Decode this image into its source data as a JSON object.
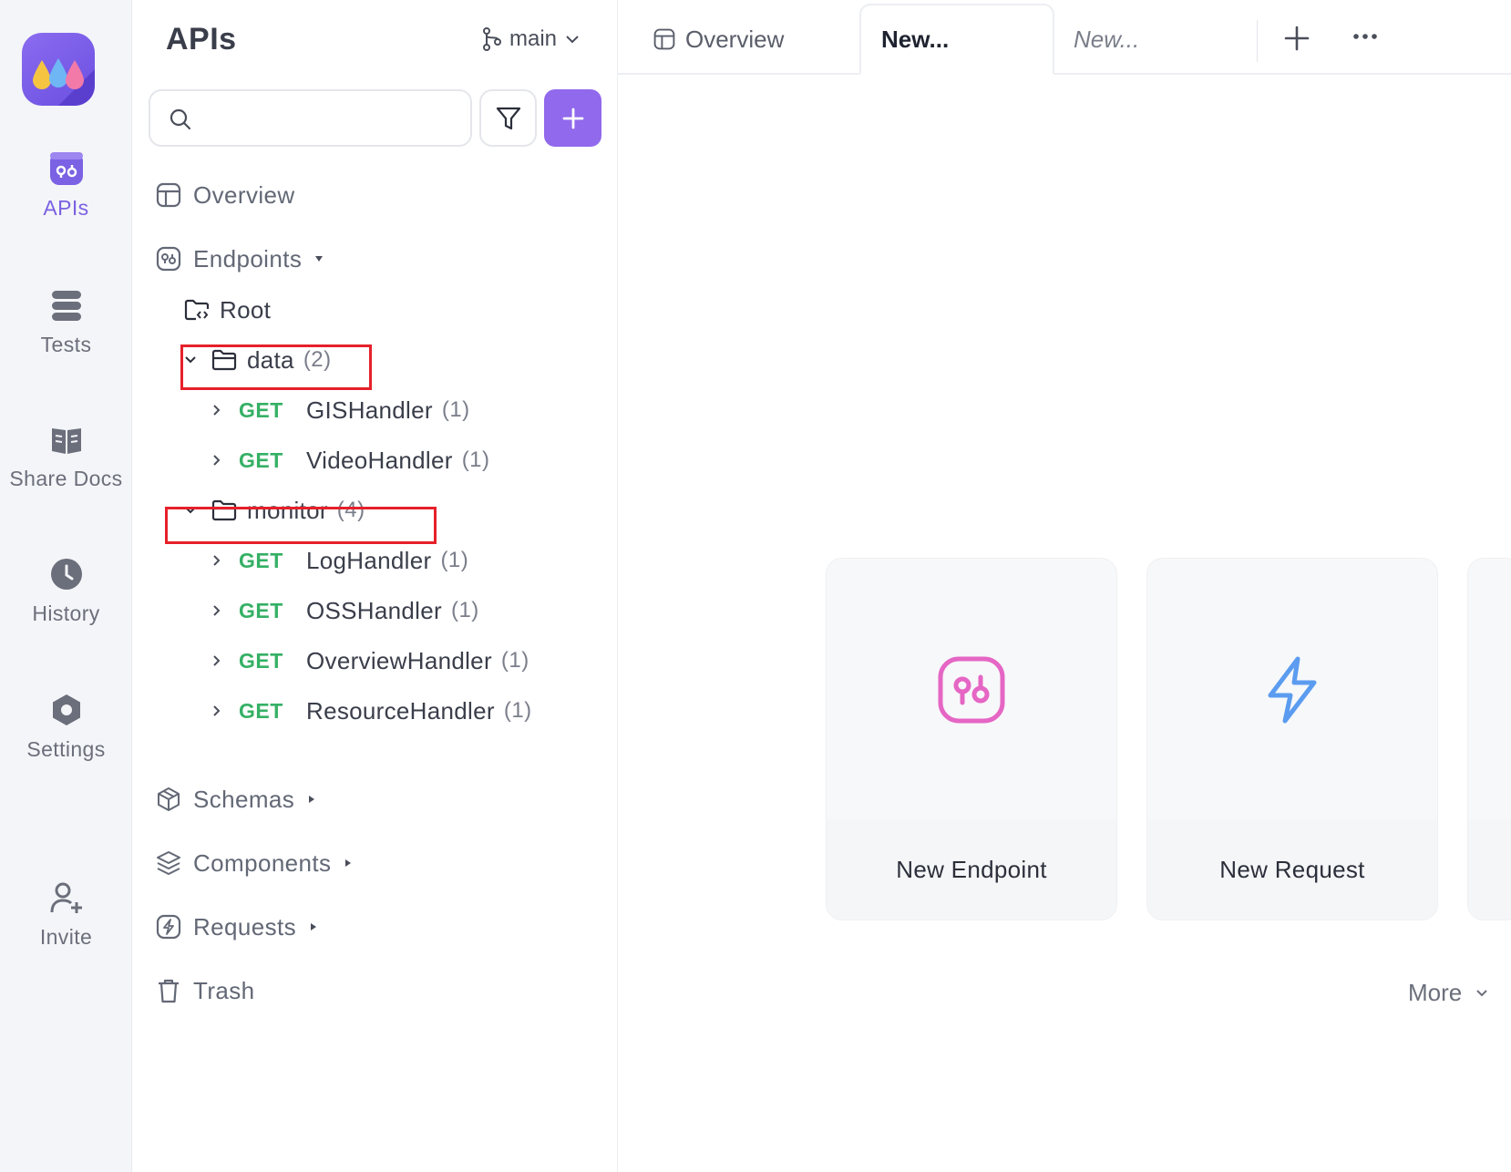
{
  "rail": {
    "items": [
      {
        "label": "APIs",
        "icon": "api-icon",
        "active": true
      },
      {
        "label": "Tests",
        "icon": "tests-icon"
      },
      {
        "label": "Share Docs",
        "icon": "book-icon"
      },
      {
        "label": "History",
        "icon": "clock-icon"
      },
      {
        "label": "Settings",
        "icon": "gear-icon"
      },
      {
        "label": "Invite",
        "icon": "user-plus-icon"
      }
    ]
  },
  "sidebar": {
    "title": "APIs",
    "branch": "main",
    "search": {
      "placeholder": "",
      "value": ""
    },
    "overview_label": "Overview",
    "endpoints_label": "Endpoints",
    "root_label": "Root",
    "folders": [
      {
        "name": "data",
        "count": "(2)",
        "items": [
          {
            "method": "GET",
            "name": "GISHandler",
            "count": "(1)"
          },
          {
            "method": "GET",
            "name": "VideoHandler",
            "count": "(1)"
          }
        ]
      },
      {
        "name": "monitor",
        "count": "(4)",
        "items": [
          {
            "method": "GET",
            "name": "LogHandler",
            "count": "(1)"
          },
          {
            "method": "GET",
            "name": "OSSHandler",
            "count": "(1)"
          },
          {
            "method": "GET",
            "name": "OverviewHandler",
            "count": "(1)"
          },
          {
            "method": "GET",
            "name": "ResourceHandler",
            "count": "(1)"
          }
        ]
      }
    ],
    "schemas_label": "Schemas",
    "components_label": "Components",
    "requests_label": "Requests",
    "trash_label": "Trash"
  },
  "tabs": {
    "overview": "Overview",
    "new1": "New...",
    "new2": "New..."
  },
  "main": {
    "cards": [
      {
        "label": "New Endpoint",
        "icon": "endpoint-icon"
      },
      {
        "label": "New Request",
        "icon": "lightning-icon"
      }
    ],
    "more_label": "More"
  },
  "colors": {
    "accent": "#9169ec",
    "get_method": "#35b065",
    "highlight": "#e6202a",
    "endpoint_icon": "#e566c4",
    "request_icon": "#5b9cf0"
  }
}
